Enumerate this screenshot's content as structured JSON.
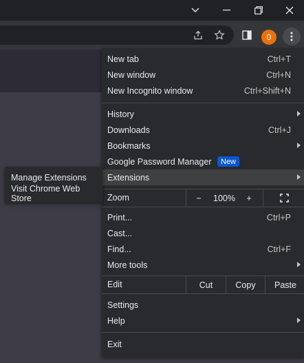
{
  "window_controls": {
    "icons": [
      "chevron-down-icon",
      "minimize-icon",
      "restore-icon",
      "close-icon"
    ]
  },
  "toolbar": {
    "icons": [
      "share-icon",
      "bookmark-star-icon",
      "side-panel-icon",
      "kebab-menu-icon"
    ],
    "profile_initial": "0"
  },
  "menu": {
    "new_tab": {
      "label": "New tab",
      "shortcut": "Ctrl+T"
    },
    "new_window": {
      "label": "New window",
      "shortcut": "Ctrl+N"
    },
    "new_incognito": {
      "label": "New Incognito window",
      "shortcut": "Ctrl+Shift+N"
    },
    "history": {
      "label": "History"
    },
    "downloads": {
      "label": "Downloads",
      "shortcut": "Ctrl+J"
    },
    "bookmarks": {
      "label": "Bookmarks"
    },
    "password_manager": {
      "label": "Google Password Manager",
      "badge": "New"
    },
    "extensions": {
      "label": "Extensions"
    },
    "zoom": {
      "label": "Zoom",
      "minus": "−",
      "value": "100%",
      "plus": "+"
    },
    "print": {
      "label": "Print...",
      "shortcut": "Ctrl+P"
    },
    "cast": {
      "label": "Cast..."
    },
    "find": {
      "label": "Find...",
      "shortcut": "Ctrl+F"
    },
    "more_tools": {
      "label": "More tools"
    },
    "edit": {
      "label": "Edit",
      "cut": "Cut",
      "copy": "Copy",
      "paste": "Paste"
    },
    "settings": {
      "label": "Settings"
    },
    "help": {
      "label": "Help"
    },
    "exit": {
      "label": "Exit"
    }
  },
  "submenu": {
    "manage_extensions": "Manage Extensions",
    "visit_store": "Visit Chrome Web Store"
  },
  "colors": {
    "menu_bg": "#292a2d",
    "highlight": "#3f4042",
    "badge": "#0b57d0",
    "profile": "#e8710a"
  }
}
